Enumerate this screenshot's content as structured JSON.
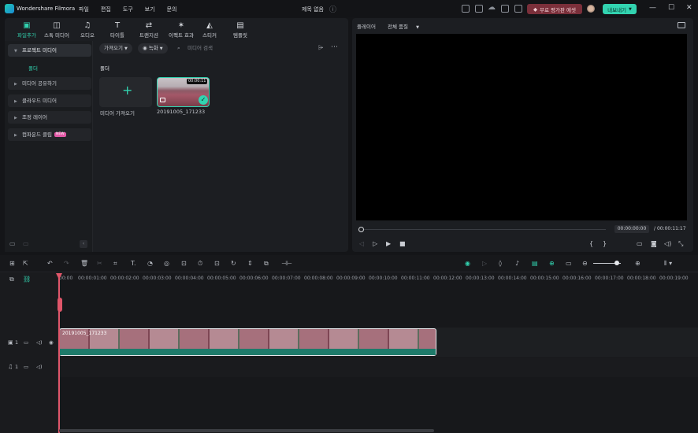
{
  "app": {
    "name": "Wondershare Filmora",
    "title": "제목 없음"
  },
  "menu": [
    "파일",
    "편집",
    "도구",
    "보기",
    "문의"
  ],
  "header": {
    "promo": "무료 평가판 에셋",
    "export": "내보내기",
    "minimize": "—",
    "maximize": "☐",
    "close": "✕"
  },
  "tabs": [
    {
      "label": "파일추가",
      "icon": "import-icon",
      "glyph": "▣"
    },
    {
      "label": "스톡 미디어",
      "icon": "stock-media-icon",
      "glyph": "◫"
    },
    {
      "label": "오디오",
      "icon": "audio-icon",
      "glyph": "♫"
    },
    {
      "label": "타이틀",
      "icon": "title-icon",
      "glyph": "T"
    },
    {
      "label": "트랜지션",
      "icon": "transition-icon",
      "glyph": "⇄"
    },
    {
      "label": "이펙트 효과",
      "icon": "effects-icon",
      "glyph": "✶"
    },
    {
      "label": "스티커",
      "icon": "sticker-icon",
      "glyph": "◭"
    },
    {
      "label": "템플릿",
      "icon": "template-icon",
      "glyph": "▤"
    }
  ],
  "sidebar": {
    "project_media": "프로젝트 미디어",
    "folder": "폴더",
    "items": [
      "미디어 공유하기",
      "클라우드 미디어",
      "조정 레이어",
      "컴파운드 클립"
    ],
    "new_badge": "NEW"
  },
  "media": {
    "import_dropdown": "가져오기",
    "record_dropdown": "녹화",
    "search_placeholder": "미디어 검색",
    "folder_label": "폴더",
    "import_card_label": "미디어 가져오기",
    "clip_name": "20191005_171233",
    "clip_duration": "00:00:11"
  },
  "player": {
    "label": "플레이어",
    "quality": "전체 품질",
    "current_time": "00:00:00:00",
    "total_time": "00:00:11:17",
    "separator": "/"
  },
  "timeline": {
    "ruler": [
      "00:00",
      "00:00:01:00",
      "00:00:02:00",
      "00:00:03:00",
      "00:00:04:00",
      "00:00:05:00",
      "00:00:06:00",
      "00:00:07:00",
      "00:00:08:00",
      "00:00:09:00",
      "00:00:10:00",
      "00:00:11:00",
      "00:00:12:00",
      "00:00:13:00",
      "00:00:14:00",
      "00:00:15:00",
      "00:00:16:00",
      "00:00:17:00",
      "00:00:18:00",
      "00:00:19:00"
    ],
    "video_track_num": "1",
    "audio_track_num": "1",
    "clip_label": "20191005_171233"
  },
  "colors": {
    "accent": "#32d3b0",
    "playhead": "#e0566a",
    "badge": "#e35aa7"
  }
}
